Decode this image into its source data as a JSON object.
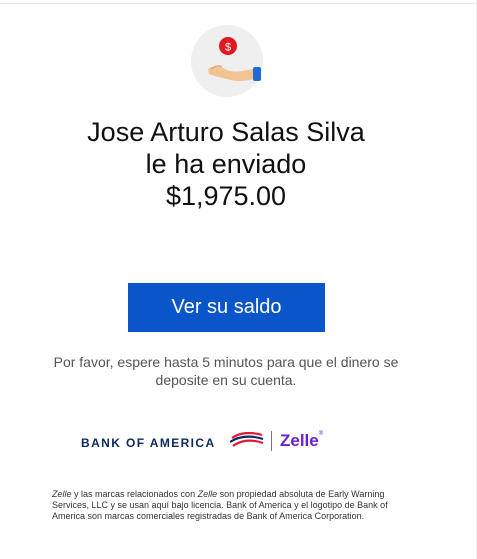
{
  "hero": {
    "icon": "hand-receiving-coin-icon",
    "coin_symbol": "$"
  },
  "headline": {
    "line1": "Jose Arturo Salas Silva",
    "line2": "le ha enviado",
    "amount": "$1,975.00"
  },
  "cta": {
    "label": "Ver su saldo",
    "color": "#0a55c9"
  },
  "notice": {
    "text": "Por favor, espere hasta 5 minutos para que el dinero se deposite en su cuenta."
  },
  "brands": {
    "boa_label": "BANK OF AMERICA",
    "boa_icon": "boa-flag-logo-icon",
    "zelle_label": "Zelle",
    "zelle_mark": "®",
    "zelle_color": "#6d1ed4",
    "boa_color": "#0f2a63"
  },
  "legal": {
    "zelle_1": "Zelle",
    "part_1": " y las marcas relacionados con ",
    "zelle_2": "Zelle",
    "part_2": " son propiedad absoluta de Early Warning Services, LLC y se usan aquí bajo licencia. Bank of America y el logotipo de Bank of America son marcas comerciales registradas de Bank of America Corporation."
  }
}
